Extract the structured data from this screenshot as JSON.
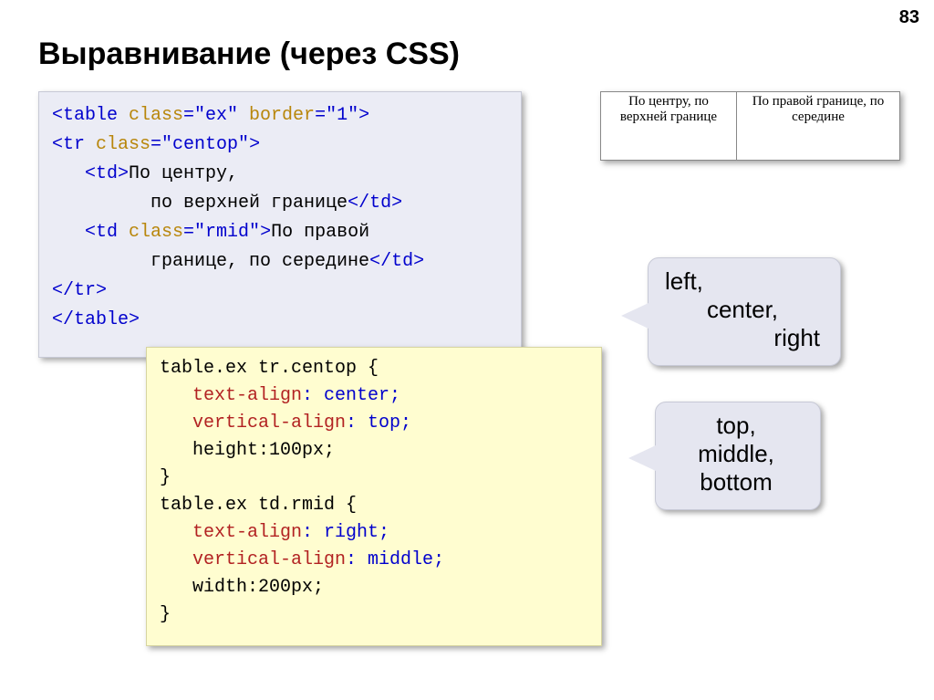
{
  "page": {
    "number": "83",
    "title": "Выравнивание (через CSS)"
  },
  "html_code": {
    "l1a": "<table",
    "l1b": " class",
    "l1c": "=\"ex\"",
    "l1d": " border",
    "l1e": "=\"1\"",
    "l1f": ">",
    "l2a": "<tr",
    "l2b": " class",
    "l2c": "=\"centop\"",
    "l2d": ">",
    "l3a": "   ",
    "l3b": "<td>",
    "l3c": "По центру,",
    "l4": "         по верхней границе",
    "l4b": "</td>",
    "l5a": "   ",
    "l5b": "<td",
    "l5c": " class",
    "l5d": "=\"rmid\"",
    "l5e": ">",
    "l5f": "По правой",
    "l6": "         границе, по середине",
    "l6b": "</td>",
    "l7": "</tr>",
    "l8": "</table>"
  },
  "css_code": {
    "s1": "table.ex tr.centop {",
    "p1": "   text-align",
    "v1": ": center;",
    "p2": "   vertical-align",
    "v2": ": top;",
    "p3": "   height:100px;",
    "c1": "}",
    "s2": "table.ex td.rmid {",
    "p4": "   text-align",
    "v4": ": right;",
    "p5": "   vertical-align",
    "v5": ": middle;",
    "p6": "   width:200px;",
    "c2": "}"
  },
  "notes": {
    "n1l1": "left,",
    "n1l2": "center,",
    "n1l3": "right",
    "n2l1": "top,",
    "n2l2": "middle,",
    "n2l3": "bottom"
  },
  "demo": {
    "cell1": "По центру, по верхней границе",
    "cell2": "По правой границе, по середине"
  }
}
